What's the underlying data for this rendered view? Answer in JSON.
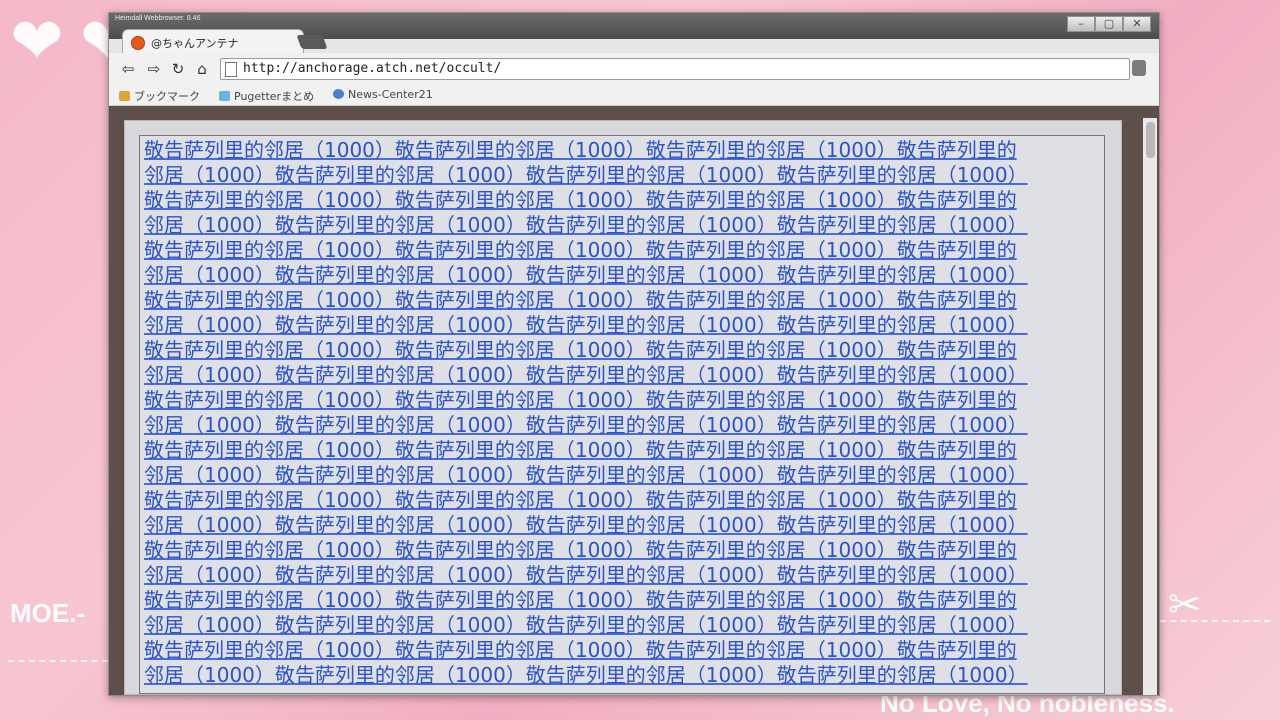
{
  "desktop": {
    "left_text": "MOE.-",
    "bottom_text": "No Love, No nobleness."
  },
  "window": {
    "title": "Heimdall Webbrowser. 8.46",
    "tab_label": "@ちゃんアンテナ",
    "url": "http://anchorage.atch.net/occult/",
    "bookmarks": [
      {
        "label": "ブックマーク"
      },
      {
        "label": "Pugetterまとめ"
      },
      {
        "label": "News-Center21"
      }
    ]
  },
  "page": {
    "lines": [
      "敬告萨列里的邻居（1000）敬告萨列里的邻居（1000）敬告萨列里的邻居（1000）敬告萨列里的",
      "邻居（1000）敬告萨列里的邻居（1000）敬告萨列里的邻居（1000）敬告萨列里的邻居（1000）",
      "敬告萨列里的邻居（1000）敬告萨列里的邻居（1000）敬告萨列里的邻居（1000）敬告萨列里的",
      "邻居（1000）敬告萨列里的邻居（1000）敬告萨列里的邻居（1000）敬告萨列里的邻居（1000）",
      "敬告萨列里的邻居（1000）敬告萨列里的邻居（1000）敬告萨列里的邻居（1000）敬告萨列里的",
      "邻居（1000）敬告萨列里的邻居（1000）敬告萨列里的邻居（1000）敬告萨列里的邻居（1000）",
      "敬告萨列里的邻居（1000）敬告萨列里的邻居（1000）敬告萨列里的邻居（1000）敬告萨列里的",
      "邻居（1000）敬告萨列里的邻居（1000）敬告萨列里的邻居（1000）敬告萨列里的邻居（1000）",
      "敬告萨列里的邻居（1000）敬告萨列里的邻居（1000）敬告萨列里的邻居（1000）敬告萨列里的",
      "邻居（1000）敬告萨列里的邻居（1000）敬告萨列里的邻居（1000）敬告萨列里的邻居（1000）",
      "敬告萨列里的邻居（1000）敬告萨列里的邻居（1000）敬告萨列里的邻居（1000）敬告萨列里的",
      "邻居（1000）敬告萨列里的邻居（1000）敬告萨列里的邻居（1000）敬告萨列里的邻居（1000）",
      "敬告萨列里的邻居（1000）敬告萨列里的邻居（1000）敬告萨列里的邻居（1000）敬告萨列里的",
      "邻居（1000）敬告萨列里的邻居（1000）敬告萨列里的邻居（1000）敬告萨列里的邻居（1000）",
      "敬告萨列里的邻居（1000）敬告萨列里的邻居（1000）敬告萨列里的邻居（1000）敬告萨列里的",
      "邻居（1000）敬告萨列里的邻居（1000）敬告萨列里的邻居（1000）敬告萨列里的邻居（1000）",
      "敬告萨列里的邻居（1000）敬告萨列里的邻居（1000）敬告萨列里的邻居（1000）敬告萨列里的",
      "邻居（1000）敬告萨列里的邻居（1000）敬告萨列里的邻居（1000）敬告萨列里的邻居（1000）",
      "敬告萨列里的邻居（1000）敬告萨列里的邻居（1000）敬告萨列里的邻居（1000）敬告萨列里的",
      "邻居（1000）敬告萨列里的邻居（1000）敬告萨列里的邻居（1000）敬告萨列里的邻居（1000）",
      "敬告萨列里的邻居（1000）敬告萨列里的邻居（1000）敬告萨列里的邻居（1000）敬告萨列里的",
      "邻居（1000）敬告萨列里的邻居（1000）敬告萨列里的邻居（1000）敬告萨列里的邻居（1000）"
    ],
    "link_color": "#2c54c8"
  },
  "icons": {
    "back": "back-arrow-icon",
    "forward": "forward-arrow-icon",
    "reload": "reload-icon",
    "home": "home-icon",
    "minimize": "minimize-icon",
    "maximize": "maximize-icon",
    "close": "close-icon"
  }
}
